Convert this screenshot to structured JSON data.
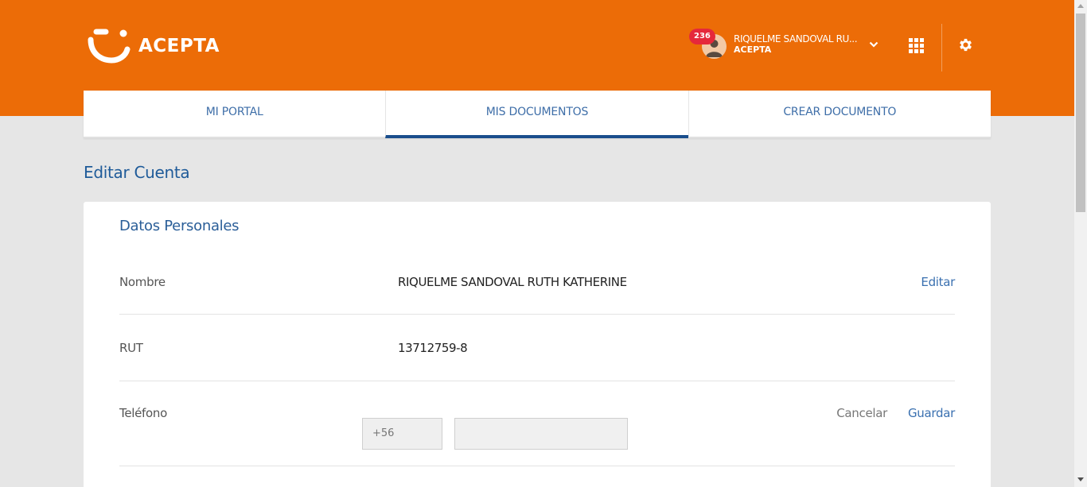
{
  "brand": {
    "name": "ACEPTA"
  },
  "user": {
    "notifications": "236",
    "name": "RIQUELME SANDOVAL RU...",
    "organization": "ACEPTA"
  },
  "tabs": [
    {
      "label": "MI PORTAL",
      "active": false
    },
    {
      "label": "MIS DOCUMENTOS",
      "active": true
    },
    {
      "label": "CREAR DOCUMENTO",
      "active": false
    }
  ],
  "page": {
    "title": "Editar Cuenta"
  },
  "personal": {
    "section_title": "Datos Personales",
    "name_label": "Nombre",
    "name_value": "RIQUELME SANDOVAL RUTH KATHERINE",
    "edit_label": "Editar",
    "rut_label": "RUT",
    "rut_value": "13712759-8",
    "phone_label": "Teléfono",
    "phone_prefix": "+56",
    "phone_value": "",
    "cancel_label": "Cancelar",
    "save_label": "Guardar"
  },
  "colors": {
    "header": "#ec6c07",
    "accent_blue": "#1a4e8c",
    "badge": "#e5283b"
  }
}
